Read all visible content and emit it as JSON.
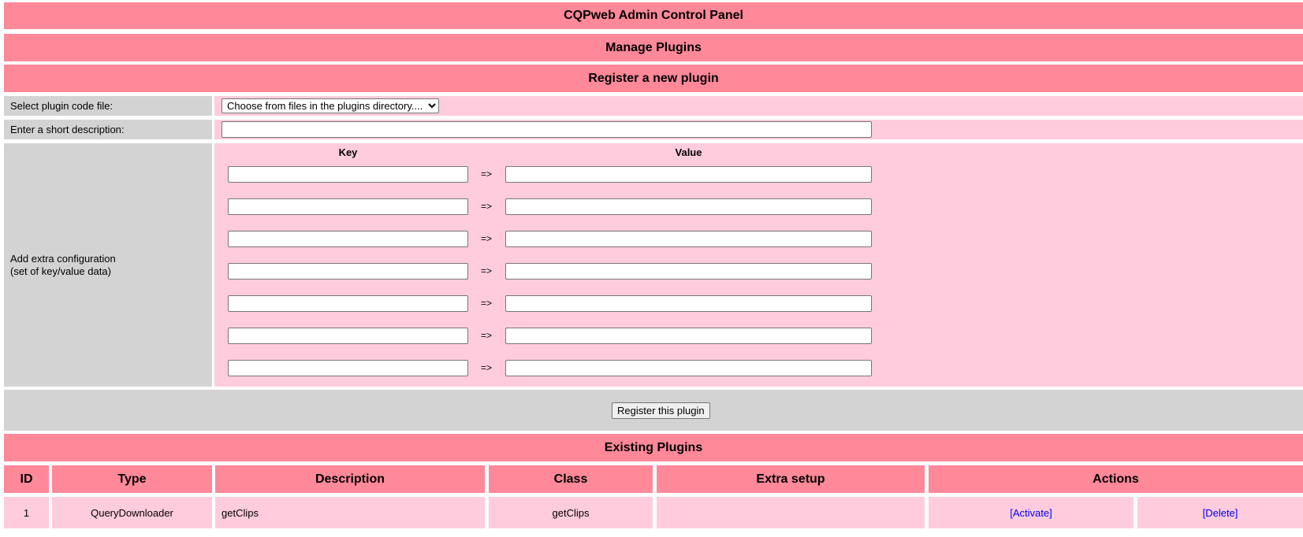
{
  "header": {
    "title": "CQPweb Admin Control Panel",
    "section": "Manage Plugins"
  },
  "register": {
    "heading": "Register a new plugin",
    "file_label": "Select plugin code file:",
    "file_select_value": "Choose from files in the plugins directory....",
    "desc_label": "Enter a short description:",
    "config_label_line1": "Add extra configuration",
    "config_label_line2": "(set of key/value data)",
    "key_header": "Key",
    "value_header": "Value",
    "arrow": "=>",
    "submit_label": "Register this plugin"
  },
  "existing": {
    "heading": "Existing Plugins",
    "columns": [
      "ID",
      "Type",
      "Description",
      "Class",
      "Extra setup",
      "Actions"
    ],
    "rows": [
      {
        "id": "1",
        "type": "QueryDownloader",
        "description": "getClips",
        "class": "getClips",
        "extra_setup": "",
        "activate": "[Activate]",
        "delete": "[Delete]"
      }
    ]
  }
}
